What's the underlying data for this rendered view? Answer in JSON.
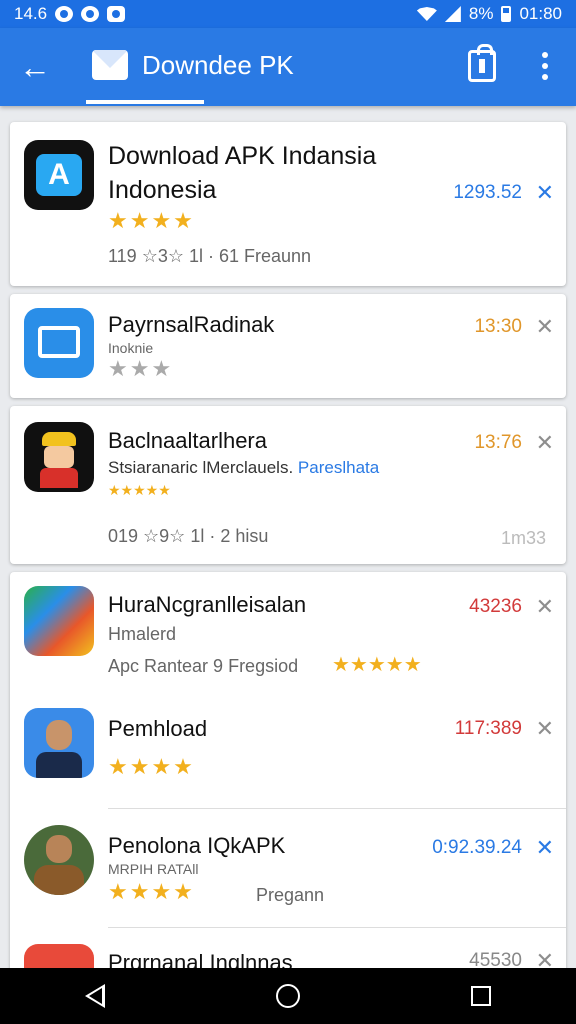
{
  "status_bar": {
    "time_left": "14.6",
    "battery": "8%",
    "clock": "01:80"
  },
  "app_bar": {
    "title": "Downdee PK",
    "back_icon": "arrow-left-icon",
    "mail_icon": "mail-icon",
    "bag_icon": "shopping-bag-icon",
    "more_icon": "more-vert-icon"
  },
  "apps": [
    {
      "name_line1": "Download APK Indansia",
      "name_line2": "Indonesia",
      "stars": "★★★★",
      "meta": "119 ☆3☆ 1l · 61 Freaunn",
      "size": "1293.52",
      "size_color": "#2a7ae4",
      "icon_bg": "#111111",
      "icon_fg": "#29a8f2"
    },
    {
      "name": "PayrnsalRadinak",
      "sub": "Inoknie",
      "stars": "★★★",
      "size": "13:30",
      "size_color": "#e0962a",
      "icon_bg": "#2a8ee8"
    },
    {
      "name": "Baclnaaltarlhera",
      "sub": "Stsiaranaric lMerclauels.",
      "sub_link": "Pareslhata",
      "stars": "★★★★★",
      "meta": "019 ☆9☆ 1l · 2 hisu",
      "meta_right": "1m33",
      "size": "13:76",
      "size_color": "#e0962a",
      "icon_bg": "#101010"
    },
    {
      "name": "HuraNcgranlleisalan",
      "sub": "Hmalerd",
      "meta": "Apc Rantear  9 Fregsiod",
      "stars": "★★★★★",
      "size": "43236",
      "size_color": "#d23a3a",
      "icon_bg": "#e8572a"
    },
    {
      "name": "Pemhload",
      "stars": "★★★★",
      "size": "117:389",
      "size_color": "#d23a3a",
      "icon_bg": "#3a8be8"
    },
    {
      "name": "Penolona IQkAPK",
      "sub": "MRPIH RATAll",
      "stars": "★★★★",
      "meta": "Pregann",
      "size": "0:92.39.24",
      "size_color": "#2a7ae4",
      "icon_bg": "#4a6a3a"
    },
    {
      "name": "Prgrnanal Inglnnas",
      "size": "45530",
      "size_color": "#888888",
      "icon_bg": "#e84a3a"
    }
  ],
  "nav": {
    "back_icon": "nav-back-icon",
    "home_icon": "nav-home-icon",
    "recent_icon": "nav-recent-icon"
  },
  "close_glyph": "✕"
}
